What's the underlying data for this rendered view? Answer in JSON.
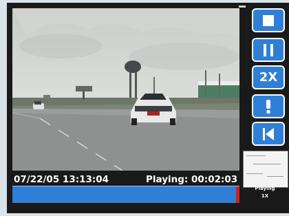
{
  "overlay": {
    "timestamp": "07/22/05 13:13:04",
    "playing": "Playing: 00:02:03"
  },
  "playback": {
    "progress_fraction": 0.99
  },
  "controls": [
    {
      "name": "stop-button",
      "icon": "stop-icon"
    },
    {
      "name": "pause-button",
      "icon": "pause-icon"
    },
    {
      "name": "speed-2x-button",
      "label": "2X"
    },
    {
      "name": "alert-button",
      "icon": "exclamation-icon"
    },
    {
      "name": "skip-back-button",
      "icon": "skip-back-icon"
    }
  ],
  "status": {
    "label": "Playing",
    "value": "1X"
  },
  "colors": {
    "accent": "#2f7fd6",
    "frame": "#1a1a1a",
    "marker": "#cc2222"
  }
}
